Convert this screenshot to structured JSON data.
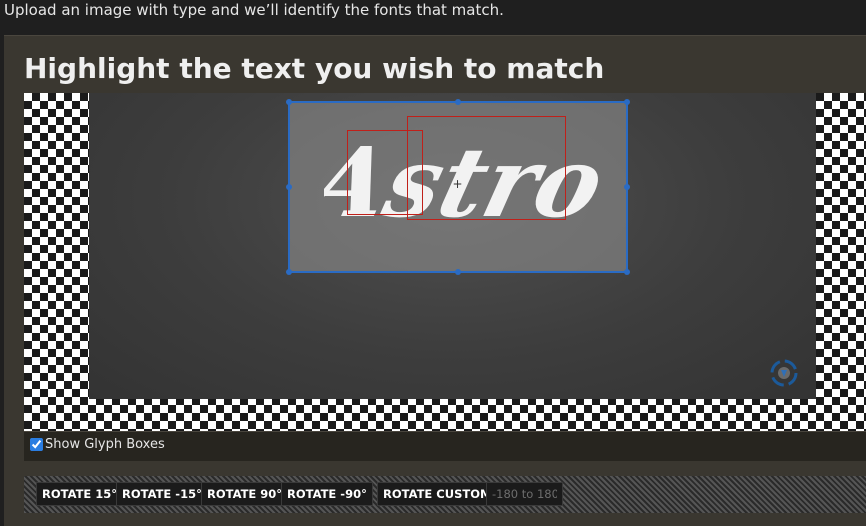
{
  "header": {
    "intro": "Upload an image with type and we’ll identify the fonts that match."
  },
  "main": {
    "title": "Highlight the text you wish to match",
    "sample_text": "Astro",
    "show_glyph_boxes": {
      "label": "Show Glyph Boxes",
      "checked": true
    }
  },
  "toolbar": {
    "rotate_15": "ROTATE 15°",
    "rotate_minus_15": "ROTATE -15°",
    "rotate_90": "ROTATE 90°",
    "rotate_minus_90": "ROTATE -90°",
    "rotate_custom": "ROTATE CUSTOM",
    "custom_placeholder": "-180 to 180"
  },
  "icons": {
    "rotate": "rotate-icon",
    "crosshair": "crosshair-icon"
  },
  "colors": {
    "selection_border": "#2a6bc4",
    "glyph_box": "#c0201a",
    "panel": "#3a3730"
  }
}
